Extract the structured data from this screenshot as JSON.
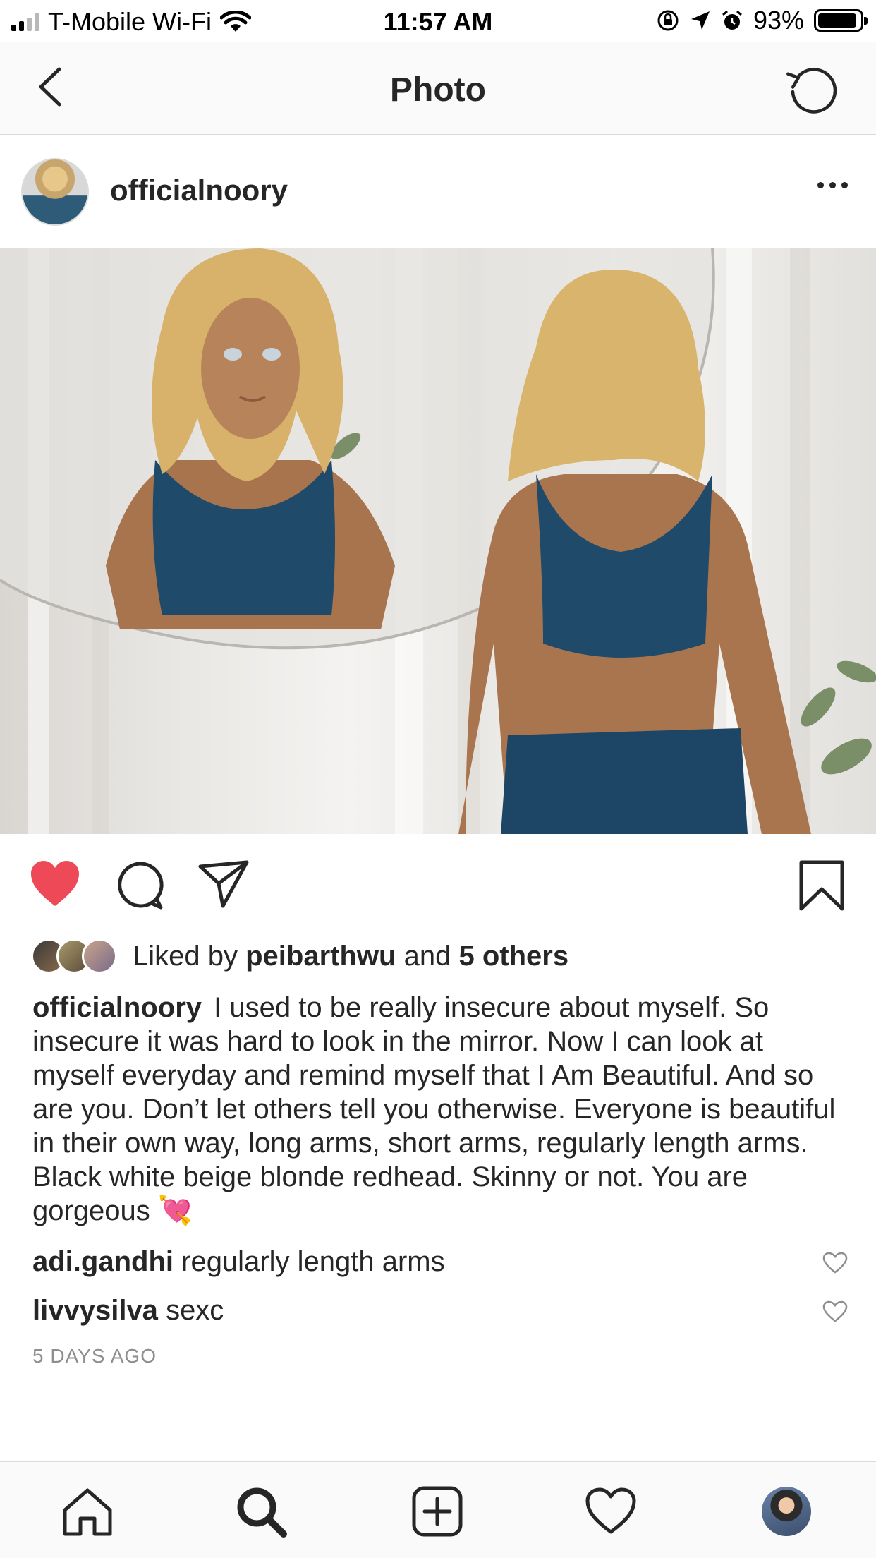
{
  "status_bar": {
    "carrier": "T-Mobile Wi-Fi",
    "time": "11:57 AM",
    "battery_percent": "93%",
    "battery_level": 0.93
  },
  "nav": {
    "title": "Photo",
    "back_icon": "chevron-left-icon",
    "refresh_icon": "refresh-icon"
  },
  "post": {
    "username": "officialnoory",
    "liked_by_prefix": "Liked by",
    "liked_by_user": "peibarthwu",
    "liked_by_and": "and",
    "liked_by_others": "5 others",
    "caption": "I used to be really insecure about myself. So insecure it was hard to look in the mirror. Now I can look at myself everyday and remind myself that I Am Beautiful. And so are you. Don’t let others tell you otherwise. Everyone is beautiful in their own way, long arms, short arms, regularly length arms. Black white beige blonde redhead. Skinny or not. You are gorgeous 💘",
    "liked": true,
    "like_color": "#ed4956",
    "comments": [
      {
        "user": "adi.gandhi",
        "text": "regularly length arms"
      },
      {
        "user": "livvysilva",
        "text": "sexc"
      }
    ],
    "timestamp": "5 DAYS AGO"
  },
  "tab_bar": {
    "items": [
      "home-icon",
      "search-icon",
      "add-post-icon",
      "activity-heart-icon",
      "profile-avatar"
    ]
  }
}
